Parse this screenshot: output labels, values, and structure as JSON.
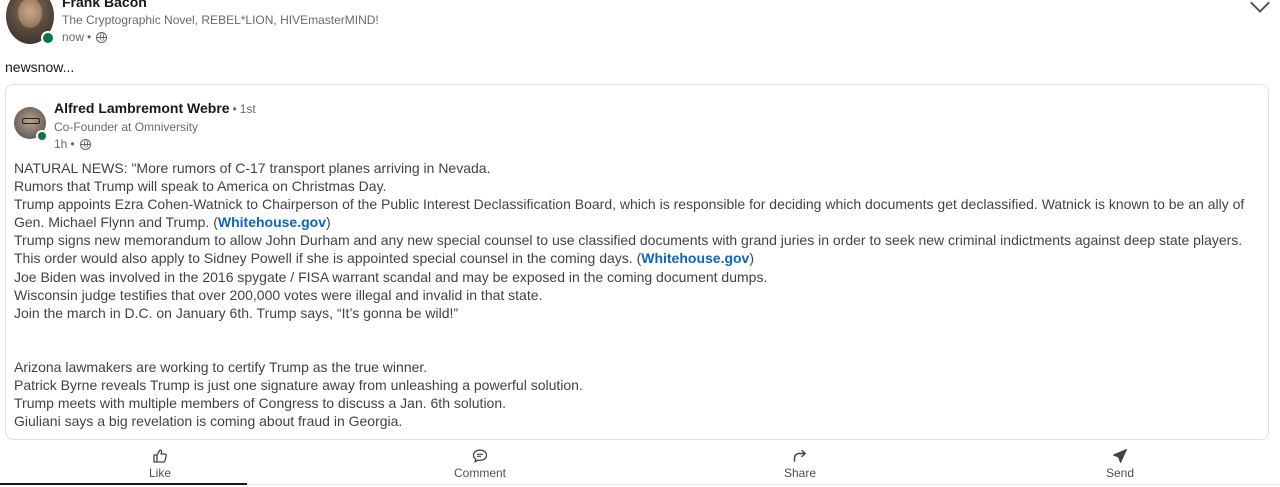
{
  "post": {
    "author_name": "Frank Bacon",
    "author_headline": "The Cryptographic Novel, REBEL*LION, HIVEmasterMIND!",
    "time": "now",
    "meta_separator": "•",
    "commentary": "newsnow..."
  },
  "shared": {
    "author_name": "Alfred Lambremont Webre",
    "degree_separator": "•",
    "degree": "1st",
    "headline": "Co-Founder at Omniversity",
    "time": "1h",
    "meta_separator": "•",
    "lines": {
      "l1": "NATURAL NEWS: \"More rumors of C-17 transport planes arriving in Nevada.",
      "l2": "Rumors that Trump will speak to America on Christmas Day.",
      "l3": "Trump appoints Ezra Cohen-Watnick to Chairperson of the Public Interest Declassification Board, which is responsible for deciding which documents get declassified. Watnick is known to be an ally of",
      "l4_pre": "Gen. Michael Flynn and Trump. (",
      "l4_link": "Whitehouse.gov",
      "l4_post": ")",
      "l5": "Trump signs new memorandum to allow John Durham and any new special counsel to use classified documents with grand juries in order to seek new criminal indictments against deep state players.",
      "l6_pre": "This order would also apply to Sidney Powell if she is appointed special counsel in the coming days. (",
      "l6_link": "Whitehouse.gov",
      "l6_post": ")",
      "l7": "Joe Biden was involved in the 2016 spygate / FISA warrant scandal and may be exposed in the coming document dumps.",
      "l8": "Wisconsin judge testifies that over 200,000 votes were illegal and invalid in that state.",
      "l9": "Join the march in D.C. on January 6th. Trump says, “It’s gonna be wild!”",
      "l10": "Arizona lawmakers are working to certify Trump as the true winner.",
      "l11": "Patrick Byrne reveals Trump is just one signature away from unleashing a powerful solution.",
      "l12": "Trump meets with multiple members of Congress to discuss a Jan. 6th solution.",
      "l13": "Giuliani says a big revelation is coming about fraud in Georgia."
    }
  },
  "actions": {
    "like": "Like",
    "comment": "Comment",
    "share": "Share",
    "send": "Send"
  },
  "icons": {
    "like": "thumbs-up-icon",
    "comment": "speech-bubble-icon",
    "share": "share-arrow-icon",
    "send": "paper-plane-icon",
    "visibility": "globe-icon",
    "menu": "chevron-down-icon"
  },
  "colors": {
    "link": "#0a66c2",
    "online": "#057642"
  }
}
